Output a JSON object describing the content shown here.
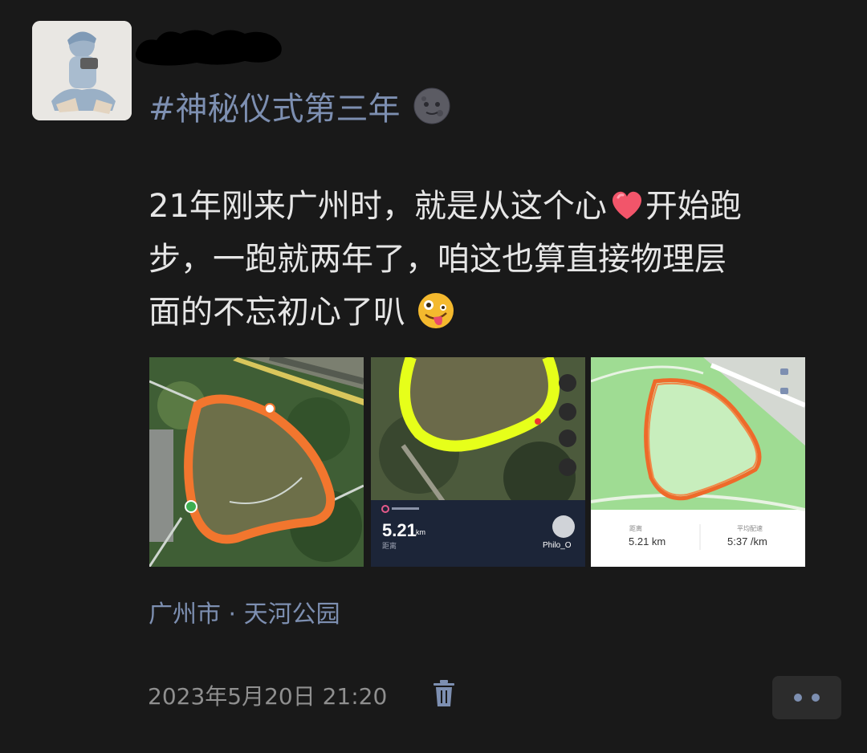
{
  "post": {
    "hashtag": "#神秘仪式第三年",
    "hashtag_emoji": "new-moon-face-emoji",
    "body_lines": [
      "21年刚来广州时，就是从这个心",
      "步，一跑就两年了，咱这也算直接物理层",
      "面的不忘初心了叭"
    ],
    "body_line1_tail": "开始跑",
    "inline_emojis": [
      "red-heart-emoji",
      "zany-face-emoji"
    ],
    "location": "广州市 · 天河公园",
    "timestamp": "2023年5月20日 21:20"
  },
  "images": {
    "img2": {
      "distance_value": "5.21",
      "distance_unit": "km",
      "distance_caption": "距离",
      "user_name": "Philo_O"
    },
    "img3": {
      "distance_label": "距离",
      "distance_value": "5.21 km",
      "pace_label": "平均配速",
      "pace_value": "5:37 /km"
    }
  },
  "icons": {
    "delete": "trash-icon",
    "more": "more-dots-icon"
  },
  "colors": {
    "link_blue": "#7d8fb1",
    "text": "#e6e6e6",
    "muted": "#8f8f8f",
    "background": "#191919",
    "route_orange": "#f2762e",
    "route_yellow": "#e6ff1a"
  }
}
